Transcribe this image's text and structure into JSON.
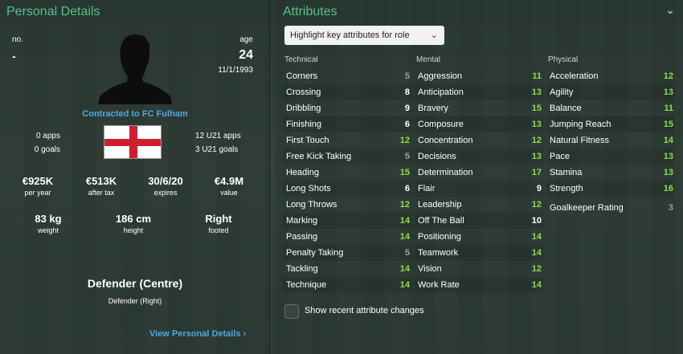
{
  "personal": {
    "title": "Personal Details",
    "no_label": "no.",
    "no_value": "-",
    "age_label": "age",
    "age_value": "24",
    "dob": "11/1/1993",
    "contract": "Contracted to FC Fulham",
    "apps": "0 apps",
    "goals": "0 goals",
    "u21_apps": "12 U21 apps",
    "u21_goals": "3 U21 goals",
    "wage": {
      "value": "€925K",
      "label": "per year"
    },
    "after_tax": {
      "value": "€513K",
      "label": "after tax"
    },
    "expires": {
      "value": "30/6/20",
      "label": "expires"
    },
    "market_value": {
      "value": "€4.9M",
      "label": "value"
    },
    "weight": {
      "value": "83 kg",
      "label": "weight"
    },
    "height": {
      "value": "186 cm",
      "label": "height"
    },
    "footed": {
      "value": "Right",
      "label": "footed"
    },
    "position": "Defender (Centre)",
    "role": "Defender (Right)",
    "view_link": "View Personal Details",
    "nationality_flag": "england-flag"
  },
  "attributes": {
    "title": "Attributes",
    "dropdown": "Highlight key attributes for role",
    "technical": {
      "heading": "Technical",
      "items": [
        {
          "name": "Corners",
          "value": "5",
          "color": "#9aa29e"
        },
        {
          "name": "Crossing",
          "value": "8",
          "color": "#ffffff"
        },
        {
          "name": "Dribbling",
          "value": "9",
          "color": "#ffffff"
        },
        {
          "name": "Finishing",
          "value": "6",
          "color": "#ffffff"
        },
        {
          "name": "First Touch",
          "value": "12",
          "color": "#8fdd4e"
        },
        {
          "name": "Free Kick Taking",
          "value": "5",
          "color": "#9aa29e"
        },
        {
          "name": "Heading",
          "value": "15",
          "color": "#8fdd4e"
        },
        {
          "name": "Long Shots",
          "value": "6",
          "color": "#ffffff"
        },
        {
          "name": "Long Throws",
          "value": "12",
          "color": "#8fdd4e"
        },
        {
          "name": "Marking",
          "value": "14",
          "color": "#8fdd4e"
        },
        {
          "name": "Passing",
          "value": "14",
          "color": "#8fdd4e"
        },
        {
          "name": "Penalty Taking",
          "value": "5",
          "color": "#9aa29e"
        },
        {
          "name": "Tackling",
          "value": "14",
          "color": "#8fdd4e"
        },
        {
          "name": "Technique",
          "value": "14",
          "color": "#8fdd4e"
        }
      ]
    },
    "mental": {
      "heading": "Mental",
      "items": [
        {
          "name": "Aggression",
          "value": "11",
          "color": "#8fdd4e"
        },
        {
          "name": "Anticipation",
          "value": "13",
          "color": "#8fdd4e"
        },
        {
          "name": "Bravery",
          "value": "15",
          "color": "#8fdd4e"
        },
        {
          "name": "Composure",
          "value": "13",
          "color": "#8fdd4e"
        },
        {
          "name": "Concentration",
          "value": "12",
          "color": "#8fdd4e"
        },
        {
          "name": "Decisions",
          "value": "13",
          "color": "#8fdd4e"
        },
        {
          "name": "Determination",
          "value": "17",
          "color": "#8fdd4e"
        },
        {
          "name": "Flair",
          "value": "9",
          "color": "#ffffff"
        },
        {
          "name": "Leadership",
          "value": "12",
          "color": "#8fdd4e"
        },
        {
          "name": "Off The Ball",
          "value": "10",
          "color": "#ffffff"
        },
        {
          "name": "Positioning",
          "value": "14",
          "color": "#8fdd4e"
        },
        {
          "name": "Teamwork",
          "value": "14",
          "color": "#8fdd4e"
        },
        {
          "name": "Vision",
          "value": "12",
          "color": "#8fdd4e"
        },
        {
          "name": "Work Rate",
          "value": "14",
          "color": "#8fdd4e"
        }
      ]
    },
    "physical": {
      "heading": "Physical",
      "items": [
        {
          "name": "Acceleration",
          "value": "12",
          "color": "#8fdd4e"
        },
        {
          "name": "Agility",
          "value": "13",
          "color": "#8fdd4e"
        },
        {
          "name": "Balance",
          "value": "11",
          "color": "#8fdd4e"
        },
        {
          "name": "Jumping Reach",
          "value": "15",
          "color": "#8fdd4e"
        },
        {
          "name": "Natural Fitness",
          "value": "14",
          "color": "#8fdd4e"
        },
        {
          "name": "Pace",
          "value": "13",
          "color": "#8fdd4e"
        },
        {
          "name": "Stamina",
          "value": "13",
          "color": "#8fdd4e"
        },
        {
          "name": "Strength",
          "value": "16",
          "color": "#8fdd4e"
        }
      ],
      "goalkeeper": {
        "name": "Goalkeeper Rating",
        "value": "3",
        "color": "#9aa29e"
      }
    },
    "show_changes": "Show recent attribute changes"
  }
}
